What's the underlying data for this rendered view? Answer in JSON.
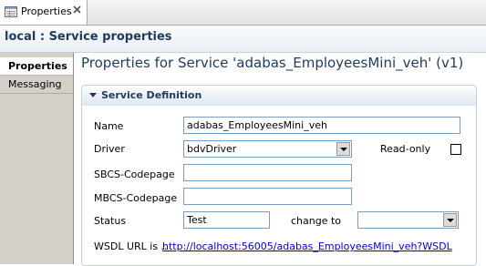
{
  "view_tab": {
    "label": "Properties"
  },
  "title": "local : Service properties",
  "side_tabs": [
    {
      "label": "Properties"
    },
    {
      "label": "Messaging"
    }
  ],
  "page_heading": "Properties for Service 'adabas_EmployeesMini_veh' (v1)",
  "section": {
    "title": "Service Definition",
    "name_label": "Name",
    "name_value": "adabas_EmployeesMini_veh",
    "driver_label": "Driver",
    "driver_value": "bdvDriver",
    "readonly_label": "Read-only",
    "readonly_checked": false,
    "sbcs_label": "SBCS-Codepage",
    "sbcs_value": "",
    "mbcs_label": "MBCS-Codepage",
    "mbcs_value": "",
    "status_label": "Status",
    "status_value": "Test",
    "change_to_label": "change to",
    "change_to_value": "",
    "wsdl_label": "WSDL URL is ..",
    "wsdl_url": "http://localhost:56005/adabas_EmployeesMini_veh?WSDL"
  }
}
